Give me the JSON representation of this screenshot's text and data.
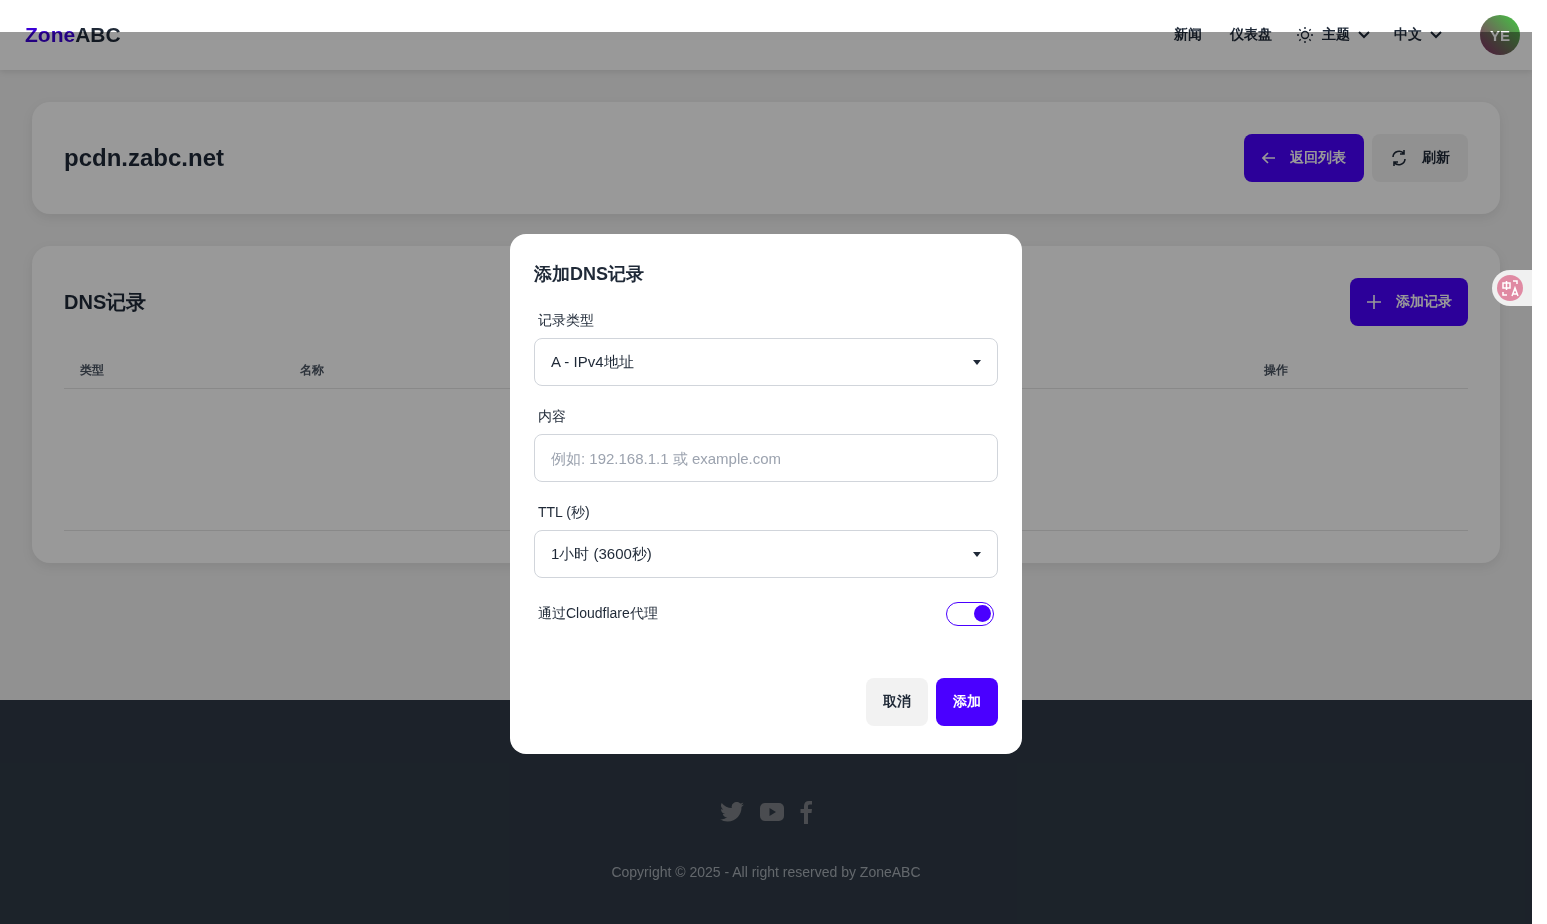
{
  "header": {
    "logo": {
      "accent": "Zone",
      "rest": "ABC"
    },
    "nav": [
      "新闻",
      "仪表盘"
    ],
    "theme": "主题",
    "language": "中文",
    "avatar": "YE"
  },
  "domain_card": {
    "title": "pcdn.zabc.net",
    "back_button": "返回列表",
    "refresh_button": "刷新"
  },
  "dns_card": {
    "title": "DNS记录",
    "add_button": "添加记录",
    "columns": [
      {
        "label": "类型"
      },
      {
        "label": "名称"
      },
      {
        "label": "操作"
      }
    ]
  },
  "dialog": {
    "title": "添加DNS记录",
    "fields": [
      {
        "kind": "select",
        "label": "记录类型",
        "value": "A - IPv4地址"
      },
      {
        "kind": "input",
        "label": "内容",
        "placeholder": "例如: 192.168.1.1 或 example.com"
      },
      {
        "kind": "select",
        "label": "TTL (秒)",
        "value": "1小时 (3600秒)"
      }
    ],
    "proxy": {
      "label": "通过Cloudflare代理",
      "on": true
    },
    "cancel_button": "取消",
    "add_button": "添加"
  },
  "footer": {
    "copyright": "Copyright © 2025 - All right reserved by ZoneABC"
  }
}
